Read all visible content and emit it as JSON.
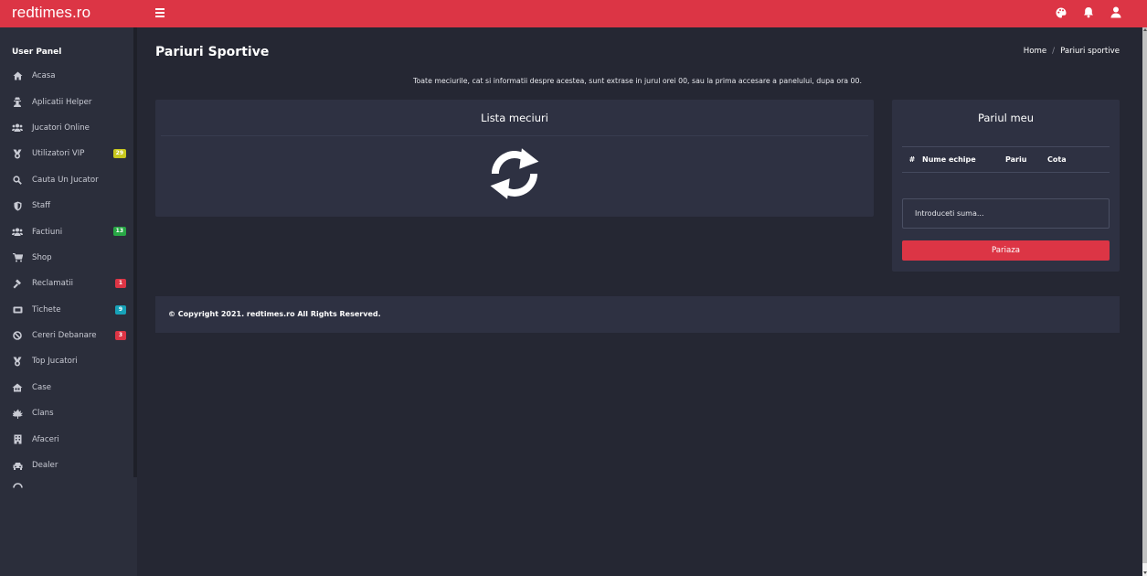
{
  "app": {
    "brand": "redtimes.ro",
    "accent": "#dc3545"
  },
  "topbar": {
    "icons": [
      "palette-icon",
      "bell-icon",
      "user-icon"
    ]
  },
  "sidebar": {
    "title": "User Panel",
    "items": [
      {
        "label": "Acasa",
        "icon": "home-icon"
      },
      {
        "label": "Aplicatii Helper",
        "icon": "user-secret-icon"
      },
      {
        "label": "Jucatori Online",
        "icon": "users-icon"
      },
      {
        "label": "Utilizatori VIP",
        "icon": "medal-icon",
        "badge": "29",
        "badge_color": "#c8c81e"
      },
      {
        "label": "Cauta Un Jucator",
        "icon": "search-icon"
      },
      {
        "label": "Staff",
        "icon": "shield-icon"
      },
      {
        "label": "Factiuni",
        "icon": "users-icon",
        "badge": "13",
        "badge_color": "#28a745"
      },
      {
        "label": "Shop",
        "icon": "cart-icon"
      },
      {
        "label": "Reclamatii",
        "icon": "gavel-icon",
        "badge": "1",
        "badge_color": "#dc3545"
      },
      {
        "label": "Tichete",
        "icon": "ticket-icon",
        "badge": "9",
        "badge_color": "#17a2b8"
      },
      {
        "label": "Cereri Debanare",
        "icon": "ban-icon",
        "badge": "3",
        "badge_color": "#dc3545"
      },
      {
        "label": "Top Jucatori",
        "icon": "medal-icon"
      },
      {
        "label": "Case",
        "icon": "house-icon"
      },
      {
        "label": "Clans",
        "icon": "leaf-icon"
      },
      {
        "label": "Afaceri",
        "icon": "building-icon"
      },
      {
        "label": "Dealer",
        "icon": "car-icon"
      },
      {
        "label": "",
        "icon": "partial-icon"
      }
    ]
  },
  "main": {
    "page_title": "Pariuri Sportive",
    "breadcrumb": {
      "home": "Home",
      "separator": "/",
      "current": "Pariuri sportive"
    },
    "notice": "Toate meciurile, cat si informatii despre acestea, sunt extrase in jurul orei 00, sau la prima accesare a panelului, dupa ora 00.",
    "matches_card": {
      "title": "Lista meciuri",
      "loading_icon": "refresh-icon"
    },
    "bet_card": {
      "title": "Pariul meu",
      "columns": [
        "#",
        "Nume echipe",
        "Pariu",
        "Cota"
      ],
      "amount_placeholder": "Introduceti suma...",
      "submit_label": "Pariaza"
    }
  },
  "footer": {
    "text": "© Copyright 2021. redtimes.ro All Rights Reserved."
  }
}
